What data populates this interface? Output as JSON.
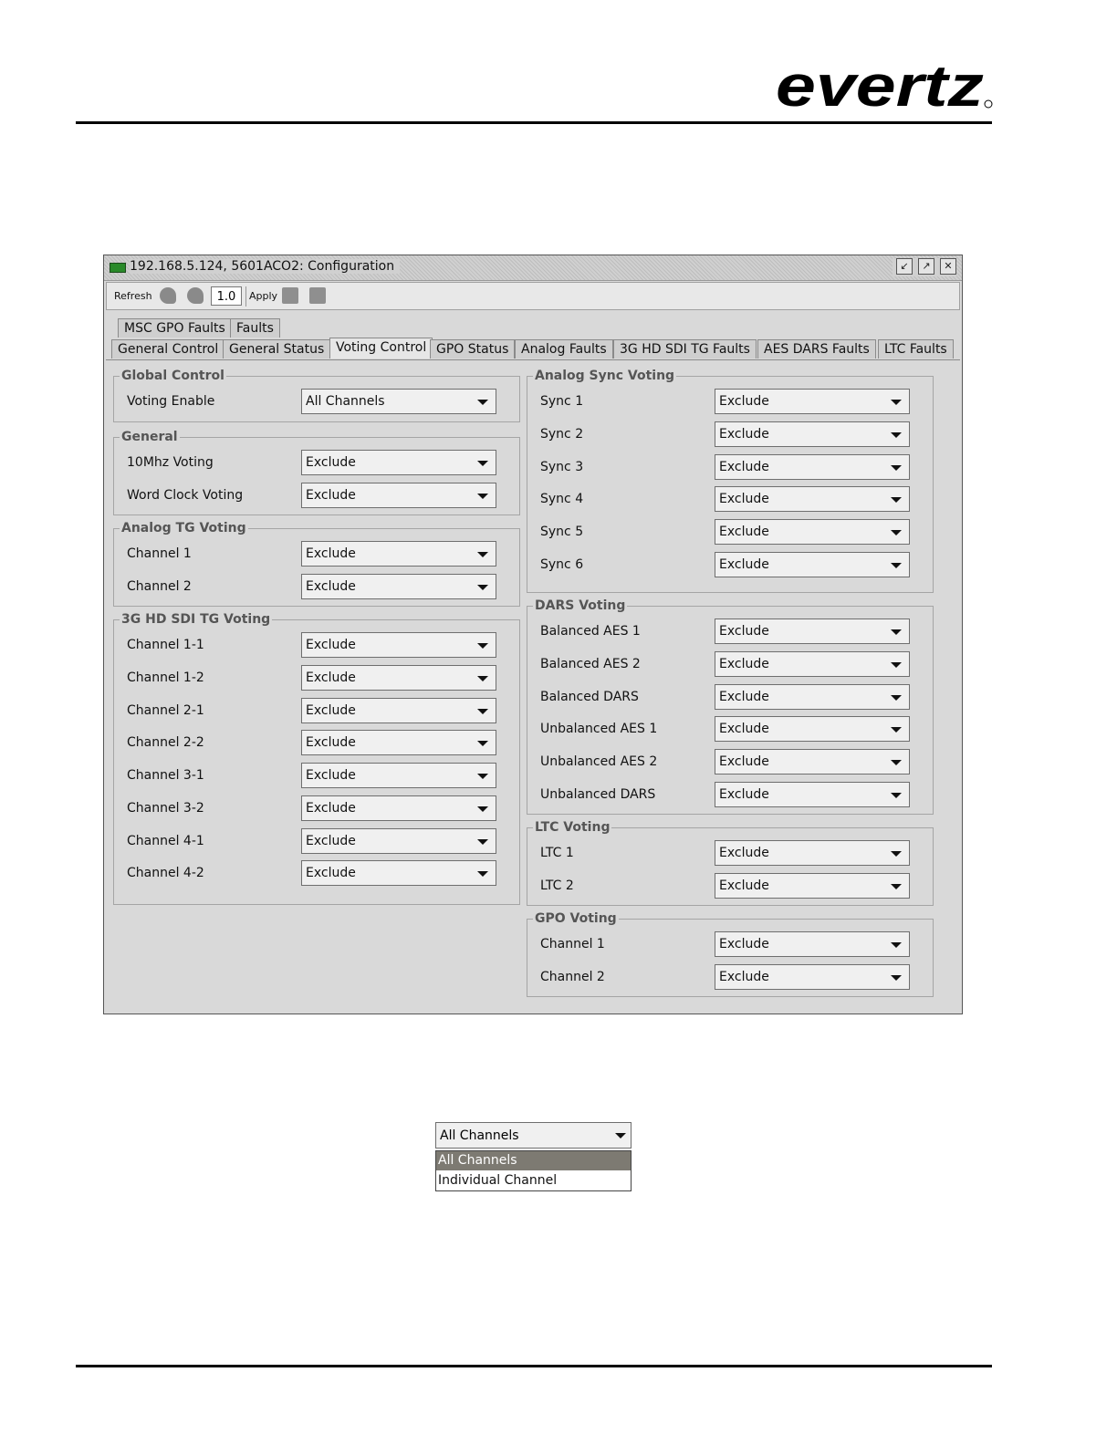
{
  "brand": {
    "logo_text": "evertz"
  },
  "window": {
    "title": "192.168.5.124, 5601ACO2: Configuration",
    "title_buttons": [
      "restore-icon",
      "maximize-icon",
      "close-icon"
    ]
  },
  "toolbar": {
    "refresh_label": "Refresh",
    "value": "1.0",
    "apply_label": "Apply"
  },
  "tabs": {
    "row1": [
      "MSC GPO Faults",
      "Faults"
    ],
    "row2": [
      "General Control",
      "General Status",
      "Voting Control",
      "GPO Status",
      "Analog Faults",
      "3G HD SDI TG Faults",
      "AES DARS Faults",
      "LTC Faults"
    ],
    "active": "Voting Control"
  },
  "groups": {
    "global_control": {
      "title": "Global Control",
      "rows": [
        {
          "label": "Voting Enable",
          "value": "All Channels"
        }
      ]
    },
    "general": {
      "title": "General",
      "rows": [
        {
          "label": "10Mhz Voting",
          "value": "Exclude"
        },
        {
          "label": "Word Clock Voting",
          "value": "Exclude"
        }
      ]
    },
    "analog_tg": {
      "title": "Analog TG Voting",
      "rows": [
        {
          "label": "Channel 1",
          "value": "Exclude"
        },
        {
          "label": "Channel 2",
          "value": "Exclude"
        }
      ]
    },
    "sdi_tg": {
      "title": "3G HD SDI TG Voting",
      "rows": [
        {
          "label": "Channel 1-1",
          "value": "Exclude"
        },
        {
          "label": "Channel 1-2",
          "value": "Exclude"
        },
        {
          "label": "Channel 2-1",
          "value": "Exclude"
        },
        {
          "label": "Channel 2-2",
          "value": "Exclude"
        },
        {
          "label": "Channel 3-1",
          "value": "Exclude"
        },
        {
          "label": "Channel 3-2",
          "value": "Exclude"
        },
        {
          "label": "Channel 4-1",
          "value": "Exclude"
        },
        {
          "label": "Channel 4-2",
          "value": "Exclude"
        }
      ]
    },
    "analog_sync": {
      "title": "Analog Sync Voting",
      "rows": [
        {
          "label": "Sync 1",
          "value": "Exclude"
        },
        {
          "label": "Sync 2",
          "value": "Exclude"
        },
        {
          "label": "Sync 3",
          "value": "Exclude"
        },
        {
          "label": "Sync 4",
          "value": "Exclude"
        },
        {
          "label": "Sync 5",
          "value": "Exclude"
        },
        {
          "label": "Sync 6",
          "value": "Exclude"
        }
      ]
    },
    "dars": {
      "title": "DARS Voting",
      "rows": [
        {
          "label": "Balanced AES 1",
          "value": "Exclude"
        },
        {
          "label": "Balanced AES 2",
          "value": "Exclude"
        },
        {
          "label": "Balanced DARS",
          "value": "Exclude"
        },
        {
          "label": "Unbalanced AES 1",
          "value": "Exclude"
        },
        {
          "label": "Unbalanced AES 2",
          "value": "Exclude"
        },
        {
          "label": "Unbalanced DARS",
          "value": "Exclude"
        }
      ]
    },
    "ltc": {
      "title": "LTC Voting",
      "rows": [
        {
          "label": "LTC 1",
          "value": "Exclude"
        },
        {
          "label": "LTC 2",
          "value": "Exclude"
        }
      ]
    },
    "gpo": {
      "title": "GPO Voting",
      "rows": [
        {
          "label": "Channel 1",
          "value": "Exclude"
        },
        {
          "label": "Channel 2",
          "value": "Exclude"
        }
      ]
    }
  },
  "dropdown_example": {
    "selected": "All Channels",
    "options": [
      "All Channels",
      "Individual Channel"
    ]
  }
}
